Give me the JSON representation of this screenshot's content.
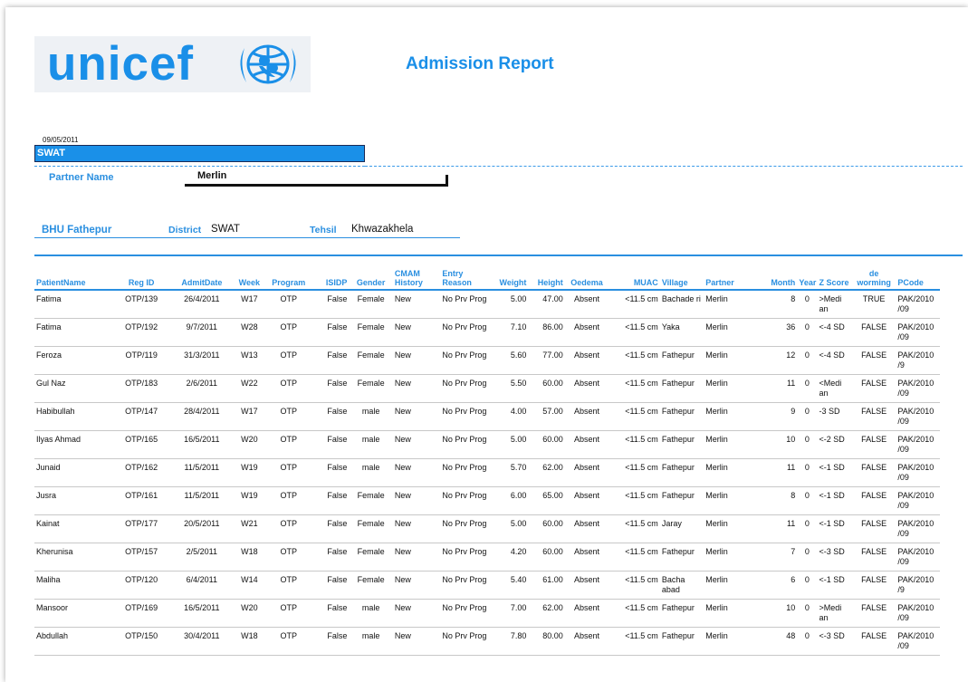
{
  "logo": {
    "text": "unicef",
    "emblem": "unicef-globe-emblem"
  },
  "report": {
    "title": "Admission Report",
    "date": "09/05/2011",
    "region": "SWAT"
  },
  "partner": {
    "label": "Partner Name",
    "value": "Merlin"
  },
  "facility": {
    "bhu": "BHU Fathepur",
    "district_label": "District",
    "district_value": "SWAT",
    "tehsil_label": "Tehsil",
    "tehsil_value": "Khwazakhela"
  },
  "colors": {
    "accent": "#1a8fe8",
    "region_bar": "#1a90e8",
    "heading": "#2a8fe0"
  },
  "table": {
    "columns": [
      "PatientName",
      "Reg ID",
      "AdmitDate",
      "Week",
      "Program",
      "ISIDP",
      "Gender",
      "CMAM History",
      "Entry Reason",
      "Weight",
      "Height",
      "Oedema",
      "MUAC",
      "Village",
      "Partner",
      "Month",
      "Year",
      "Z Score",
      "de worming",
      "PCode"
    ],
    "rows": [
      [
        "Fatima",
        "OTP/139",
        "26/4/2011",
        "W17",
        "OTP",
        "False",
        "Female",
        "New",
        "No Prv Prog",
        "5.00",
        "47.00",
        "Absent",
        "<11.5 cm",
        "Bachade ri",
        "Merlin",
        "8",
        "0",
        ">Medi an",
        "TRUE",
        "PAK/2010 /09"
      ],
      [
        "Fatima",
        "OTP/192",
        "9/7/2011",
        "W28",
        "OTP",
        "False",
        "Female",
        "New",
        "No Prv Prog",
        "7.10",
        "86.00",
        "Absent",
        "<11.5 cm",
        "Yaka",
        "Merlin",
        "36",
        "0",
        "<-4 SD",
        "FALSE",
        "PAK/2010 /09"
      ],
      [
        "Feroza",
        "OTP/119",
        "31/3/2011",
        "W13",
        "OTP",
        "False",
        "Female",
        "New",
        "No Prv Prog",
        "5.60",
        "77.00",
        "Absent",
        "<11.5 cm",
        "Fathepur",
        "Merlin",
        "12",
        "0",
        "<-4 SD",
        "FALSE",
        "PAK/2010 /9"
      ],
      [
        "Gul Naz",
        "OTP/183",
        "2/6/2011",
        "W22",
        "OTP",
        "False",
        "Female",
        "New",
        "No Prv Prog",
        "5.50",
        "60.00",
        "Absent",
        "<11.5 cm",
        "Fathepur",
        "Merlin",
        "11",
        "0",
        "<Medi an",
        "FALSE",
        "PAK/2010 /09"
      ],
      [
        "Habibullah",
        "OTP/147",
        "28/4/2011",
        "W17",
        "OTP",
        "False",
        "male",
        "New",
        "No Prv Prog",
        "4.00",
        "57.00",
        "Absent",
        "<11.5 cm",
        "Fathepur",
        "Merlin",
        "9",
        "0",
        "-3 SD",
        "FALSE",
        "PAK/2010 /09"
      ],
      [
        "Ilyas Ahmad",
        "OTP/165",
        "16/5/2011",
        "W20",
        "OTP",
        "False",
        "male",
        "New",
        "No Prv Prog",
        "5.00",
        "60.00",
        "Absent",
        "<11.5 cm",
        "Fathepur",
        "Merlin",
        "10",
        "0",
        "<-2 SD",
        "FALSE",
        "PAK/2010 /09"
      ],
      [
        "Junaid",
        "OTP/162",
        "11/5/2011",
        "W19",
        "OTP",
        "False",
        "male",
        "New",
        "No Prv Prog",
        "5.70",
        "62.00",
        "Absent",
        "<11.5 cm",
        "Fathepur",
        "Merlin",
        "11",
        "0",
        "<-1 SD",
        "FALSE",
        "PAK/2010 /09"
      ],
      [
        "Jusra",
        "OTP/161",
        "11/5/2011",
        "W19",
        "OTP",
        "False",
        "Female",
        "New",
        "No Prv Prog",
        "6.00",
        "65.00",
        "Absent",
        "<11.5 cm",
        "Fathepur",
        "Merlin",
        "8",
        "0",
        "<-1 SD",
        "FALSE",
        "PAK/2010 /09"
      ],
      [
        "Kainat",
        "OTP/177",
        "20/5/2011",
        "W21",
        "OTP",
        "False",
        "Female",
        "New",
        "No Prv Prog",
        "5.00",
        "60.00",
        "Absent",
        "<11.5 cm",
        "Jaray",
        "Merlin",
        "11",
        "0",
        "<-1 SD",
        "FALSE",
        "PAK/2010 /09"
      ],
      [
        "Kherunisa",
        "OTP/157",
        "2/5/2011",
        "W18",
        "OTP",
        "False",
        "Female",
        "New",
        "No Prv Prog",
        "4.20",
        "60.00",
        "Absent",
        "<11.5 cm",
        "Fathepur",
        "Merlin",
        "7",
        "0",
        "<-3 SD",
        "FALSE",
        "PAK/2010 /09"
      ],
      [
        "Maliha",
        "OTP/120",
        "6/4/2011",
        "W14",
        "OTP",
        "False",
        "Female",
        "New",
        "No Prv Prog",
        "5.40",
        "61.00",
        "Absent",
        "<11.5 cm",
        "Bacha abad",
        "Merlin",
        "6",
        "0",
        "<-1 SD",
        "FALSE",
        "PAK/2010 /9"
      ],
      [
        "Mansoor",
        "OTP/169",
        "16/5/2011",
        "W20",
        "OTP",
        "False",
        "male",
        "New",
        "No Prv Prog",
        "7.00",
        "62.00",
        "Absent",
        "<11.5 cm",
        "Fathepur",
        "Merlin",
        "10",
        "0",
        ">Medi an",
        "FALSE",
        "PAK/2010 /09"
      ],
      [
        "Abdullah",
        "OTP/150",
        "30/4/2011",
        "W18",
        "OTP",
        "False",
        "male",
        "New",
        "No Prv Prog",
        "7.80",
        "80.00",
        "Absent",
        "<11.5 cm",
        "Fathepur",
        "Merlin",
        "48",
        "0",
        "<-3 SD",
        "FALSE",
        "PAK/2010 /09"
      ]
    ]
  }
}
